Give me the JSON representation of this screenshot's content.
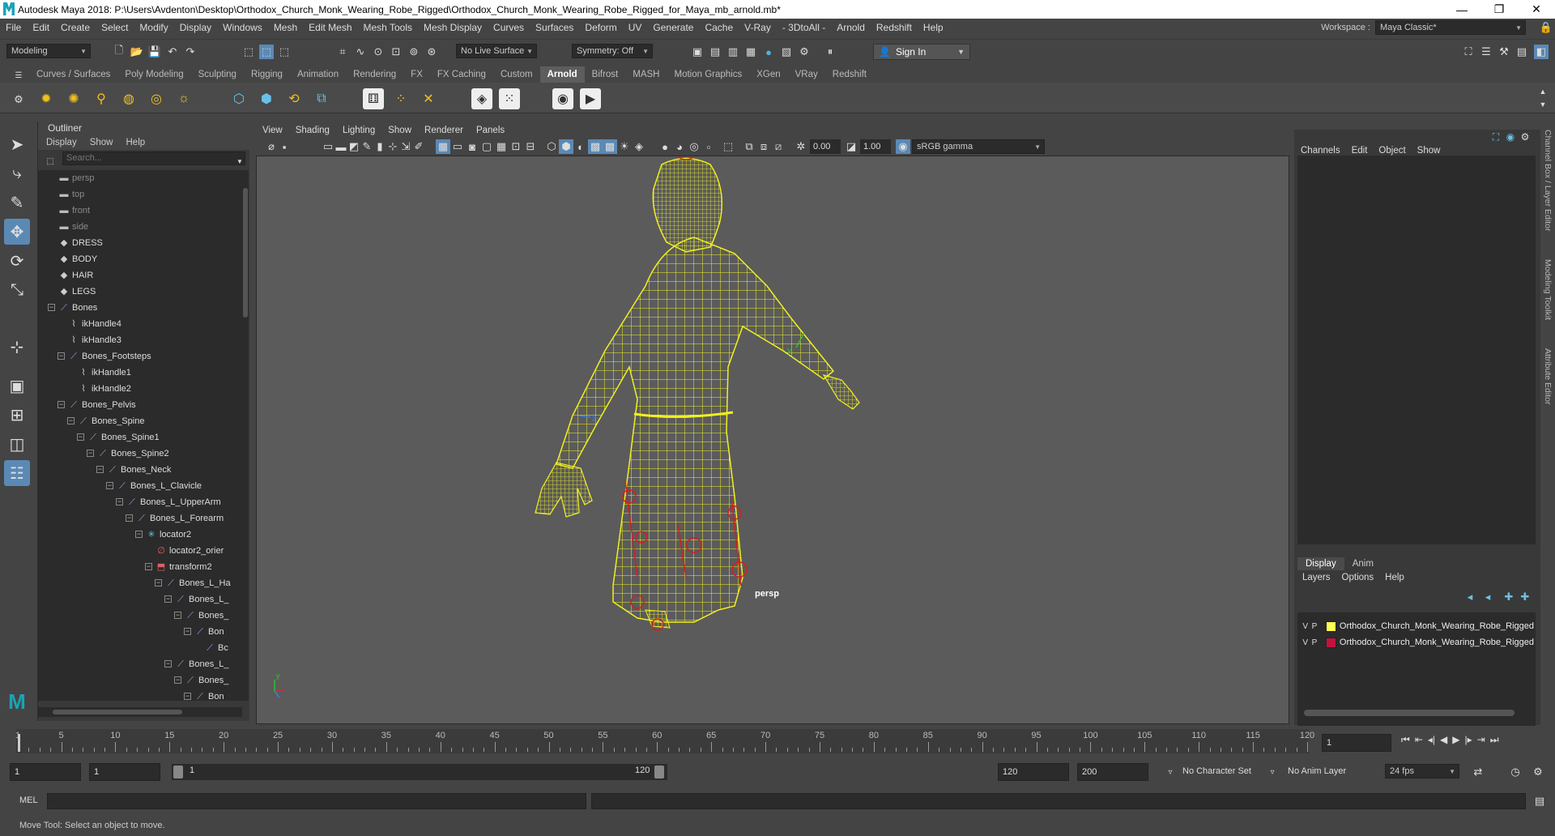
{
  "window": {
    "title": "Autodesk Maya 2018: P:\\Users\\Avdenton\\Desktop\\Orthodox_Church_Monk_Wearing_Robe_Rigged\\Orthodox_Church_Monk_Wearing_Robe_Rigged_for_Maya_mb_arnold.mb*",
    "minimize": "—",
    "maximize": "❐",
    "close": "✕"
  },
  "menubar": {
    "items": [
      "File",
      "Edit",
      "Create",
      "Select",
      "Modify",
      "Display",
      "Windows",
      "Mesh",
      "Edit Mesh",
      "Mesh Tools",
      "Mesh Display",
      "Curves",
      "Surfaces",
      "Deform",
      "UV",
      "Generate",
      "Cache",
      "V-Ray",
      "- 3DtoAll -",
      "Arnold",
      "Redshift",
      "Help"
    ],
    "workspace_label": "Workspace :",
    "workspace_value": "Maya Classic*"
  },
  "statusline": {
    "mode": "Modeling",
    "live_surface": "No Live Surface",
    "symmetry": "Symmetry: Off",
    "sign_in": "Sign In"
  },
  "shelf": {
    "tabs": [
      "Curves / Surfaces",
      "Poly Modeling",
      "Sculpting",
      "Rigging",
      "Animation",
      "Rendering",
      "FX",
      "FX Caching",
      "Custom",
      "Arnold",
      "Bifrost",
      "MASH",
      "Motion Graphics",
      "XGen",
      "VRay",
      "Redshift"
    ],
    "active_tab": "Arnold"
  },
  "outliner": {
    "title": "Outliner",
    "menu": [
      "Display",
      "Show",
      "Help"
    ],
    "search_placeholder": "Search...",
    "items": [
      {
        "label": "persp",
        "depth": 0,
        "icon": "camera-icon",
        "dim": true
      },
      {
        "label": "top",
        "depth": 0,
        "icon": "camera-icon",
        "dim": true
      },
      {
        "label": "front",
        "depth": 0,
        "icon": "camera-icon",
        "dim": true
      },
      {
        "label": "side",
        "depth": 0,
        "icon": "camera-icon",
        "dim": true
      },
      {
        "label": "DRESS",
        "depth": 0,
        "icon": "mesh-icon"
      },
      {
        "label": "BODY",
        "depth": 0,
        "icon": "mesh-icon"
      },
      {
        "label": "HAIR",
        "depth": 0,
        "icon": "mesh-icon"
      },
      {
        "label": "LEGS",
        "depth": 0,
        "icon": "mesh-icon"
      },
      {
        "label": "Bones",
        "depth": 0,
        "icon": "joint-icon",
        "exp": "−"
      },
      {
        "label": "ikHandle4",
        "depth": 1,
        "icon": "ik-handle-icon"
      },
      {
        "label": "ikHandle3",
        "depth": 1,
        "icon": "ik-handle-icon"
      },
      {
        "label": "Bones_Footsteps",
        "depth": 1,
        "icon": "joint-icon",
        "exp": "−"
      },
      {
        "label": "ikHandle1",
        "depth": 2,
        "icon": "ik-handle-icon"
      },
      {
        "label": "ikHandle2",
        "depth": 2,
        "icon": "ik-handle-icon"
      },
      {
        "label": "Bones_Pelvis",
        "depth": 1,
        "icon": "joint-icon",
        "exp": "−"
      },
      {
        "label": "Bones_Spine",
        "depth": 2,
        "icon": "joint-icon",
        "exp": "−"
      },
      {
        "label": "Bones_Spine1",
        "depth": 3,
        "icon": "joint-icon",
        "exp": "−"
      },
      {
        "label": "Bones_Spine2",
        "depth": 4,
        "icon": "joint-icon",
        "exp": "−"
      },
      {
        "label": "Bones_Neck",
        "depth": 5,
        "icon": "joint-icon",
        "exp": "−"
      },
      {
        "label": "Bones_L_Clavicle",
        "depth": 6,
        "icon": "joint-icon",
        "exp": "−"
      },
      {
        "label": "Bones_L_UpperArm",
        "depth": 7,
        "icon": "joint-icon",
        "exp": "−"
      },
      {
        "label": "Bones_L_Forearm",
        "depth": 8,
        "icon": "joint-icon",
        "exp": "−"
      },
      {
        "label": "locator2",
        "depth": 9,
        "icon": "locator-icon",
        "exp": "−"
      },
      {
        "label": "locator2_orier",
        "depth": 10,
        "icon": "constraint-icon"
      },
      {
        "label": "transform2",
        "depth": 10,
        "icon": "transform-icon",
        "exp": "−"
      },
      {
        "label": "Bones_L_Ha",
        "depth": 11,
        "icon": "joint-icon",
        "exp": "−"
      },
      {
        "label": "Bones_L_",
        "depth": 12,
        "icon": "joint-icon",
        "exp": "−"
      },
      {
        "label": "Bones_",
        "depth": 13,
        "icon": "joint-icon",
        "exp": "−"
      },
      {
        "label": "Bon",
        "depth": 14,
        "icon": "joint-icon",
        "exp": "−"
      },
      {
        "label": "Bc",
        "depth": 15,
        "icon": "joint-icon"
      },
      {
        "label": "Bones_L_",
        "depth": 12,
        "icon": "joint-icon",
        "exp": "−"
      },
      {
        "label": "Bones_",
        "depth": 13,
        "icon": "joint-icon",
        "exp": "−"
      },
      {
        "label": "Bon",
        "depth": 14,
        "icon": "joint-icon",
        "exp": "−"
      }
    ]
  },
  "viewport": {
    "menu": [
      "View",
      "Shading",
      "Lighting",
      "Show",
      "Renderer",
      "Panels"
    ],
    "exposure": "0.00",
    "gamma": "1.00",
    "color_space": "sRGB gamma",
    "camera": "persp",
    "axis_x": "x",
    "axis_y": "y",
    "axis_z": "z"
  },
  "channel_box": {
    "menu": [
      "Channels",
      "Edit",
      "Object",
      "Show"
    ],
    "tabs": [
      "Display",
      "Anim"
    ],
    "active_tab": "Display",
    "layer_menu": [
      "Layers",
      "Options",
      "Help"
    ],
    "layers": [
      {
        "v": "V",
        "p": "P",
        "color": "#ffff55",
        "name": "Orthodox_Church_Monk_Wearing_Robe_Rigged"
      },
      {
        "v": "V",
        "p": "P",
        "color": "#c0143c",
        "name": "Orthodox_Church_Monk_Wearing_Robe_Rigged"
      }
    ]
  },
  "side_tabs": [
    "Channel Box / Layer Editor",
    "Modeling Toolkit",
    "Attribute Editor"
  ],
  "timeline": {
    "ticks": [
      "1",
      "5",
      "10",
      "15",
      "20",
      "25",
      "30",
      "35",
      "40",
      "45",
      "50",
      "55",
      "60",
      "65",
      "70",
      "75",
      "80",
      "85",
      "90",
      "95",
      "100",
      "105",
      "110",
      "115",
      "120"
    ],
    "current_frame": "1"
  },
  "range": {
    "start": "1",
    "anim_start": "1",
    "range_start": "1",
    "range_end": "120",
    "playback_end": "120",
    "anim_end": "200",
    "character_set": "No Character Set",
    "anim_layer": "No Anim Layer",
    "fps": "24 fps"
  },
  "command_line": {
    "language": "MEL"
  },
  "help_line": "Move Tool: Select an object to move.",
  "colors": {
    "wireframe": "#f0f020",
    "rig": "#d02020",
    "accent": "#5b89b5",
    "arnold_tab": "#5d5d5d"
  }
}
